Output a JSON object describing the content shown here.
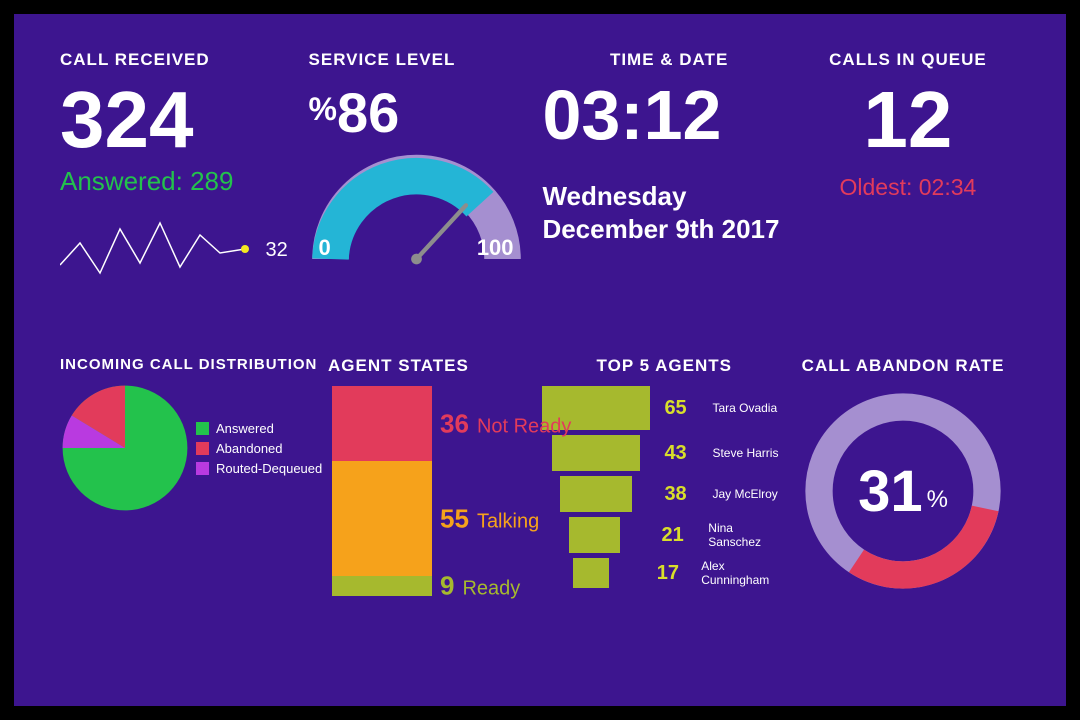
{
  "top": {
    "call_received": {
      "title": "CALL RECEIVED",
      "value": "324",
      "answered_label": "Answered: 289",
      "spark_last": "32"
    },
    "service_level": {
      "title": "SERVICE LEVEL",
      "percent": "86",
      "min": "0",
      "max": "100"
    },
    "time_date": {
      "title": "TIME & DATE",
      "time": "03:12",
      "day": "Wednesday",
      "date": "December 9th 2017"
    },
    "calls_in_queue": {
      "title": "CALLS IN QUEUE",
      "value": "12",
      "oldest_label": "Oldest: 02:34"
    }
  },
  "bottom": {
    "dist": {
      "title": "INCOMING CALL DISTRIBUTION",
      "legend": [
        "Answered",
        "Abandoned",
        "Routed-Dequeued"
      ]
    },
    "agent_states": {
      "title": "AGENT STATES",
      "not_ready": {
        "value": "36",
        "label": "Not Ready"
      },
      "talking": {
        "value": "55",
        "label": "Talking"
      },
      "ready": {
        "value": "9",
        "label": "Ready"
      }
    },
    "top5": {
      "title": "TOP 5 AGENTS",
      "agents": [
        {
          "value": "65",
          "name": "Tara Ovadia"
        },
        {
          "value": "43",
          "name": "Steve Harris"
        },
        {
          "value": "38",
          "name": "Jay McElroy"
        },
        {
          "value": "21",
          "name": "Nina Sanschez"
        },
        {
          "value": "17",
          "name": "Alex Cunningham"
        }
      ]
    },
    "abandon": {
      "title": "CALL ABANDON RATE",
      "value": "31"
    }
  },
  "colors": {
    "green": "#23c24c",
    "red": "#e23b5b",
    "cyan": "#24b5d6",
    "lavender": "#a58fd0",
    "orange": "#f6a21b",
    "olive": "#a6b92e",
    "lime_text": "#d9de2a",
    "magenta": "#b93ae0"
  },
  "chart_data": [
    {
      "type": "line",
      "name": "call_received_spark",
      "values": [
        18,
        36,
        12,
        46,
        18,
        52,
        20,
        44,
        30,
        32
      ],
      "last_value_label": 32
    },
    {
      "type": "gauge",
      "name": "service_level_gauge",
      "value": 86,
      "min": 0,
      "max": 100,
      "colors": {
        "fill": "#24b5d6",
        "remainder": "#a58fd0"
      }
    },
    {
      "type": "pie",
      "name": "incoming_call_distribution",
      "slices": [
        {
          "label": "Answered",
          "value": 72,
          "color": "#23c24c"
        },
        {
          "label": "Abandoned",
          "value": 14,
          "color": "#e23b5b"
        },
        {
          "label": "Routed-Dequeued",
          "value": 14,
          "color": "#b93ae0"
        }
      ]
    },
    {
      "type": "bar",
      "name": "agent_states",
      "orientation": "stacked-vertical",
      "categories": [
        "Not Ready",
        "Talking",
        "Ready"
      ],
      "values": [
        36,
        55,
        9
      ],
      "colors": [
        "#e23b5b",
        "#f6a21b",
        "#a6b92e"
      ]
    },
    {
      "type": "bar",
      "name": "top5_agents_funnel",
      "orientation": "horizontal",
      "categories": [
        "Tara Ovadia",
        "Steve Harris",
        "Jay McElroy",
        "Nina Sanschez",
        "Alex Cunningham"
      ],
      "values": [
        65,
        43,
        38,
        21,
        17
      ],
      "color": "#a6b92e"
    },
    {
      "type": "pie",
      "name": "call_abandon_rate_donut",
      "donut": true,
      "slices": [
        {
          "label": "abandon",
          "value": 31,
          "color": "#e23b5b"
        },
        {
          "label": "other",
          "value": 69,
          "color": "#a58fd0"
        }
      ],
      "center_text": "31%"
    }
  ]
}
